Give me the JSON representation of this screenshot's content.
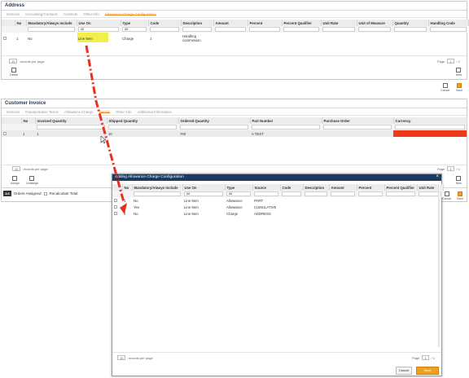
{
  "address": {
    "title": "Address",
    "tabs": [
      "General",
      "Accounting/Contacts",
      "Contacts",
      "Other Info",
      "Allowance Charge Configuration"
    ],
    "active_tab": 4,
    "columns": [
      "",
      "No",
      "Mandatory/Always Include",
      "Use On",
      "Type",
      "Code",
      "Description",
      "Amount",
      "Percent",
      "Percent Qualifier",
      "Unit Rate",
      "Unit of Measure",
      "Quantity",
      "Handling Code"
    ],
    "filters": {
      "use_on": "All",
      "type": "All"
    },
    "row": {
      "no": "1",
      "mandatory": "No",
      "use_on": "Line Item",
      "type": "Charge",
      "code": "1",
      "description": "Handling commission"
    },
    "pager": {
      "per_page": "10",
      "per_page_label": "records per page",
      "page_label": "Page",
      "page": "1",
      "of": "/ 1"
    },
    "delete_label": "Delete",
    "new_label": "New"
  },
  "mid_actions": {
    "cancel": "Cancel",
    "save": "Save"
  },
  "invoice": {
    "title": "Customer Invoice",
    "tabs": [
      "General",
      "Transportation Terms",
      "Allowance Charge",
      "Details",
      "Other Info",
      "Additional Information"
    ],
    "active_tab": 3,
    "columns": [
      "",
      "No",
      "Invoiced Quantity",
      "Shipped Quantity",
      "Ordered Quantity",
      "Part Number",
      "Purchase Order",
      "Currency"
    ],
    "row": {
      "no": "1",
      "invoiced": "1",
      "shipped": "10",
      "ordered": "700",
      "part": "A TEST"
    },
    "pager": {
      "per_page": "10",
      "per_page_label": "records per page",
      "page_label": "Page",
      "page": "1",
      "of": "/ 1"
    },
    "assign": "Assign",
    "unassign": "Unassign",
    "new_label": "New",
    "cancel": "Cancel",
    "save": "Save"
  },
  "bottom_bar": {
    "badge": "1/4",
    "orders": "Orders Assigned",
    "recalc": "Recalculate Total"
  },
  "modal": {
    "title": "Adding Allowance Charge Configuration",
    "columns": [
      "",
      "No",
      "Mandatory/Always Include",
      "Use On",
      "Type",
      "Source",
      "Code",
      "Description",
      "Amount",
      "Percent",
      "Percent Qualifier",
      "Unit Rate"
    ],
    "filters": {
      "use_on": "All",
      "type": "All"
    },
    "rows": [
      {
        "no": "1",
        "mandatory": "No",
        "use_on": "Line Item",
        "type": "Allowance",
        "source": "PART"
      },
      {
        "no": "2",
        "mandatory": "Yes",
        "use_on": "Line Item",
        "type": "Allowance",
        "source": "CUMULATIVE"
      },
      {
        "no": "3",
        "mandatory": "No",
        "use_on": "Line Item",
        "type": "Charge",
        "source": "ADDRESS"
      }
    ],
    "pager": {
      "per_page": "10",
      "per_page_label": "records per page",
      "page_label": "Page",
      "page": "1",
      "of": "/ 1"
    },
    "cancel": "Cancel",
    "save": "Save"
  },
  "colors": {
    "accent": "#e8871e",
    "highlight": "#f2ee4a",
    "currency_cell": "#ee3a1a",
    "arrow": "#e83020",
    "modal_header": "#1f3a5f"
  }
}
